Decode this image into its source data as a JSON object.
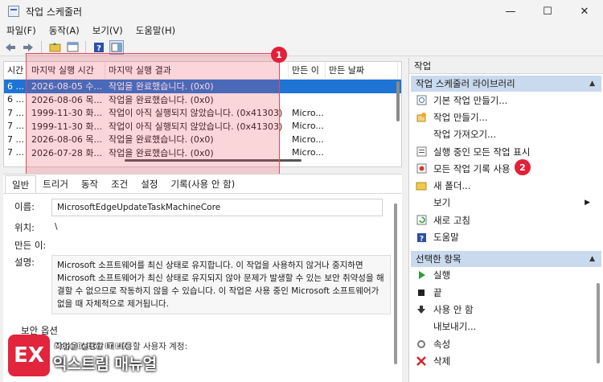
{
  "window": {
    "title": "작업 스케줄러",
    "minimize": "—",
    "maximize": "☐",
    "close": "✕"
  },
  "menu": [
    "파일(F)",
    "동작(A)",
    "보기(V)",
    "도움말(H)"
  ],
  "list": {
    "headers": [
      "시간",
      "마지막 실행 시간",
      "마지막 실행 결과",
      "만든 이",
      "만든 날짜"
    ],
    "rows": [
      [
        "6 ...",
        "2026-08-05 수...",
        "작업을 완료했습니다. (0x0)",
        "",
        ""
      ],
      [
        "6 ...",
        "2026-08-06 목...",
        "작업을 완료했습니다. (0x0)",
        "",
        ""
      ],
      [
        "7 ...",
        "1999-11-30 화...",
        "작업이 아직 실행되지 않았습니다. (0x41303)",
        "Micro...",
        ""
      ],
      [
        "7 ...",
        "1999-11-30 화...",
        "작업이 아직 실행되지 않았습니다. (0x41303)",
        "Micro...",
        ""
      ],
      [
        "7 ...",
        "2026-08-06 목...",
        "작업을 완료했습니다. (0x0)",
        "Micro...",
        ""
      ],
      [
        "7 ...",
        "2026-07-28 화...",
        "작업을 완료했습니다. (0x0)",
        "Micro...",
        ""
      ]
    ],
    "selected_row": 0
  },
  "callouts": {
    "one": "1",
    "two": "2"
  },
  "details": {
    "tabs": [
      "일반",
      "트리거",
      "동작",
      "조건",
      "설정",
      "기록(사용 안 함)"
    ],
    "name_label": "이름:",
    "name_value": "MicrosoftEdgeUpdateTaskMachineCore",
    "location_label": "위치:",
    "location_value": "\\",
    "author_label": "만든 이:",
    "description_label": "설명:",
    "description_value": "Microsoft 소프트웨어를 최신 상태로 유지합니다. 이 작업을 사용하지 않거나 중지하면 Microsoft 소프트웨어가 최신 상태로 유지되지 않아 문제가 발생할 수 있는 보안 취약성을 해결할 수 없으므로 작동하지 않을 수 있습니다. 이 작업은 사용 중인 Microsoft 소프트웨어가 없을 때 자체적으로 제거됩니다.",
    "security_label": "보안 옵션",
    "security_sub": "작업을 실행할 때 사용할 사용자 계정:"
  },
  "logo": {
    "mark": "EX",
    "tagline": "More Better IT Life",
    "name": "익스트림 매뉴얼"
  },
  "actions": {
    "header": "작업",
    "section1": "작업 스케줄러 라이브러리",
    "items1": [
      {
        "label": "기본 작업 만들기...",
        "icon": "basic-task-icon"
      },
      {
        "label": "작업 만들기...",
        "icon": "create-task-icon"
      },
      {
        "label": "작업 가져오기...",
        "icon": ""
      },
      {
        "label": "실행 중인 모든 작업 표시",
        "icon": "running-tasks-icon"
      },
      {
        "label": "모든 작업 기록 사용",
        "icon": "history-icon"
      },
      {
        "label": "새 폴더...",
        "icon": "folder-icon"
      },
      {
        "label": "보기",
        "icon": "",
        "submenu": true
      },
      {
        "label": "새로 고침",
        "icon": "refresh-icon"
      },
      {
        "label": "도움말",
        "icon": "help-icon"
      }
    ],
    "section2": "선택한 항목",
    "items2": [
      {
        "label": "실행",
        "icon": "run-icon"
      },
      {
        "label": "끝",
        "icon": "end-icon"
      },
      {
        "label": "사용 안 함",
        "icon": "disable-icon"
      },
      {
        "label": "내보내기...",
        "icon": ""
      },
      {
        "label": "속성",
        "icon": "properties-icon"
      },
      {
        "label": "삭제",
        "icon": "delete-icon"
      }
    ]
  }
}
